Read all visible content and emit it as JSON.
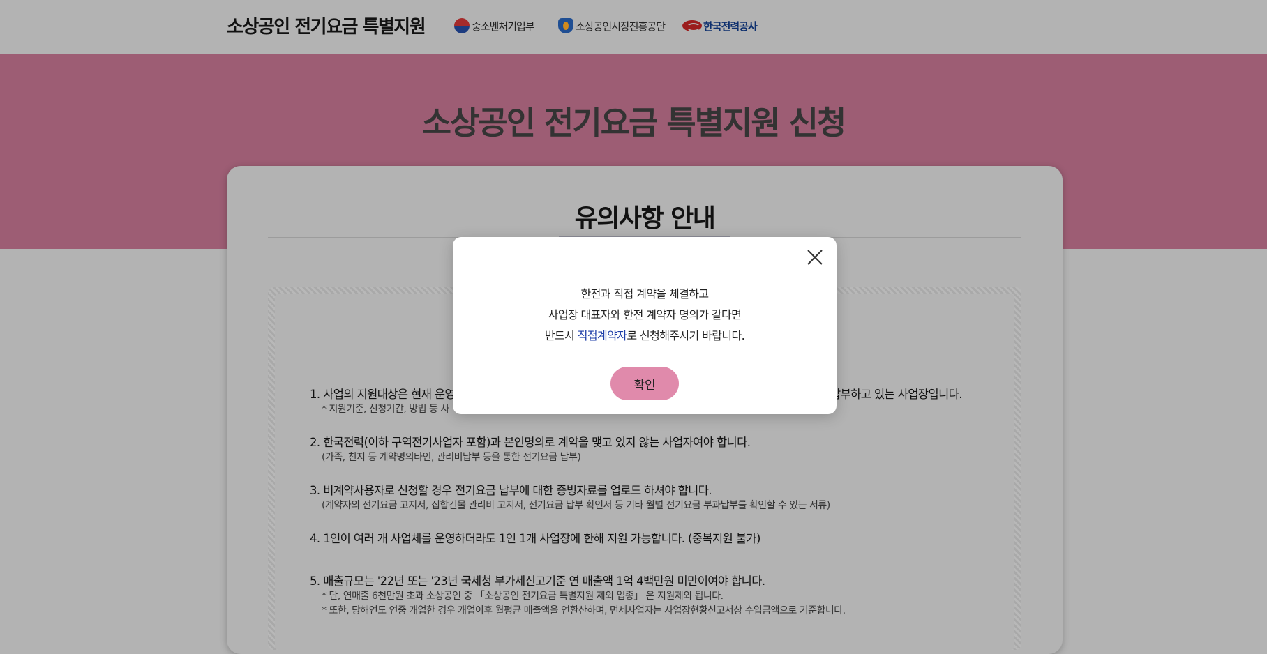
{
  "header": {
    "brand": "소상공인 전기요금 특별지원",
    "orgs": [
      {
        "name": "중소벤처기업부",
        "icon": "taegeuk-emblem-icon"
      },
      {
        "name": "소상공인시장진흥공단",
        "icon": "semas-emblem-icon"
      },
      {
        "name": "한국전력공사",
        "icon": "kepco-logo-icon"
      }
    ]
  },
  "banner": {
    "title": "소상공인 전기요금 특별지원 신청"
  },
  "card": {
    "title": "유의사항 안내",
    "items": [
      {
        "main": "1. 사업의 지원대상은 현재 운영",
        "main_right": "납부하고 있는 사업장입니다.",
        "subs": [
          "* 지원기준, 신청기간, 방법 등 사"
        ]
      },
      {
        "main": "2. 한국전력(이하 구역전기사업자 포함)과 본인명의로 계약을 맺고 있지 않는 사업자여야 합니다.",
        "subs": [
          "(가족, 친지 등 계약명의타인, 관리비납부 등을 통한 전기요금 납부)"
        ]
      },
      {
        "main": "3. 비계약사용자로 신청할 경우 전기요금 납부에 대한 증빙자료를 업로드 하셔야 합니다.",
        "subs": [
          "(계약자의 전기요금 고지서, 집합건물 관리비 고지서, 전기요금 납부 확인서 등 기타 월별 전기요금 부과납부를 확인할 수 있는 서류)"
        ]
      },
      {
        "main": "4. 1인이 여러 개 사업체를 운영하더라도 1인 1개 사업장에 한해 지원 가능합니다. (중복지원 불가)",
        "subs": []
      },
      {
        "main": "5. 매출규모는 '22년 또는 '23년 국세청 부가세신고기준 연 매출액 1억 4백만원 미만이여야 합니다.",
        "subs": [
          "* 단, 연매출 6천만원 초과 소상공인 중 「소상공인 전기요금 특별지원 제외 업종」 은 지원제외 됩니다.",
          "* 또한, 당해연도 연중 개업한 경우 개업이후 월평균 매출액을 연환산하며, 면세사업자는 사업장현황신고서상 수입금액으로 기준합니다."
        ]
      }
    ]
  },
  "modal": {
    "line1": "한전과 직접 계약을 체결하고",
    "line2": "사업장 대표자와 한전 계약자 명의가 같다면",
    "line3_before": "반드시 ",
    "line3_highlight": "직접계약자",
    "line3_after": "로 신청해주시기 바랍니다.",
    "confirm_label": "확인",
    "highlight_color": "#1f3fa8",
    "button_color": "#e08aab"
  }
}
